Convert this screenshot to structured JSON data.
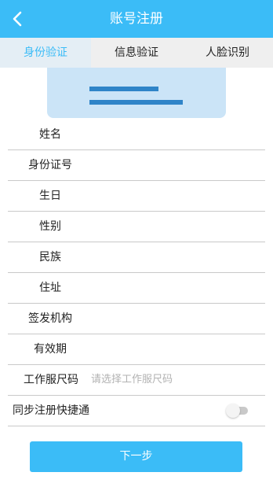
{
  "header": {
    "title": "账号注册",
    "back_icon": "chevron-left-icon"
  },
  "tabs": [
    {
      "label": "身份验证",
      "active": true
    },
    {
      "label": "信息验证",
      "active": false
    },
    {
      "label": "人脸识别",
      "active": false
    }
  ],
  "form": {
    "name_label": "姓名",
    "id_label": "身份证号",
    "birthday_label": "生日",
    "gender_label": "性别",
    "ethnicity_label": "民族",
    "address_label": "住址",
    "issuer_label": "签发机构",
    "validity_label": "有效期",
    "uniform_label": "工作服尺码",
    "uniform_placeholder": "请选择工作服尺码",
    "sync_label": "同步注册快捷通",
    "sync_on": false
  },
  "next_button": "下一步",
  "colors": {
    "accent": "#3bbcf7",
    "card": "#cbe4f7",
    "card_bar": "#2f84c8"
  }
}
